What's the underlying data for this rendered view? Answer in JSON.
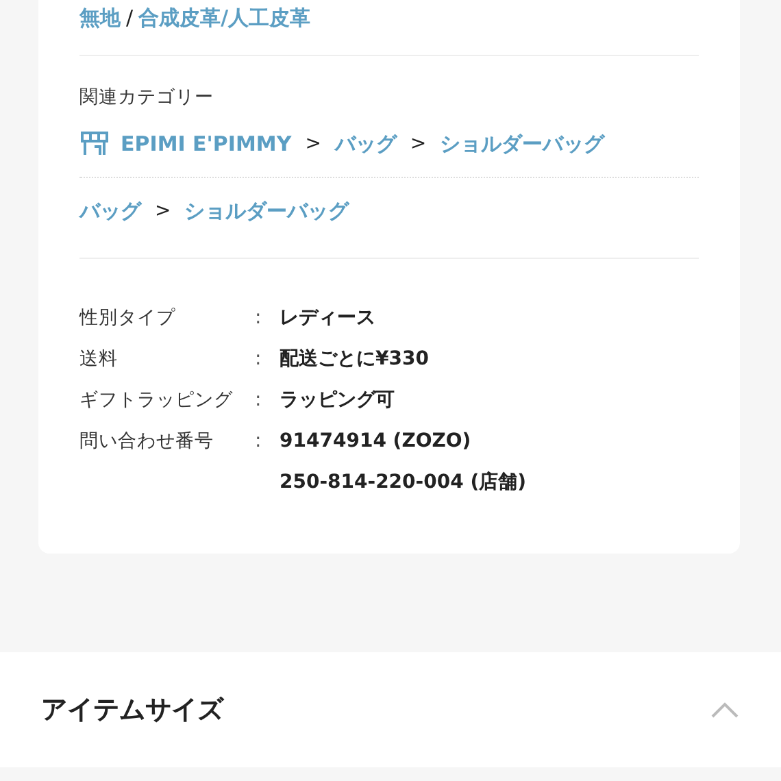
{
  "materials": {
    "items": [
      "無地",
      "合成皮革/人工皮革"
    ],
    "separators": [
      "/"
    ]
  },
  "related_categories": {
    "label": "関連カテゴリー",
    "paths": [
      {
        "kind": "shop",
        "items": [
          "EPIMI E'PIMMY",
          "バッグ",
          "ショルダーバッグ"
        ],
        "separators": [
          ">",
          ">"
        ]
      },
      {
        "kind": "category",
        "items": [
          "バッグ",
          "ショルダーバッグ"
        ],
        "separators": [
          ">"
        ]
      }
    ]
  },
  "specs": [
    {
      "label": "性別タイプ",
      "colon": ":",
      "values": [
        "レディース"
      ]
    },
    {
      "label": "送料",
      "colon": ":",
      "values": [
        "配送ごとに¥330"
      ]
    },
    {
      "label": "ギフトラッピング",
      "colon": ":",
      "values": [
        "ラッピング可"
      ]
    },
    {
      "label": "問い合わせ番号",
      "colon": ":",
      "values": [
        "91474914 (ZOZO)",
        "250-814-220-004 (店舗)"
      ]
    }
  ],
  "accordion": {
    "title": "アイテムサイズ",
    "expanded": true
  }
}
